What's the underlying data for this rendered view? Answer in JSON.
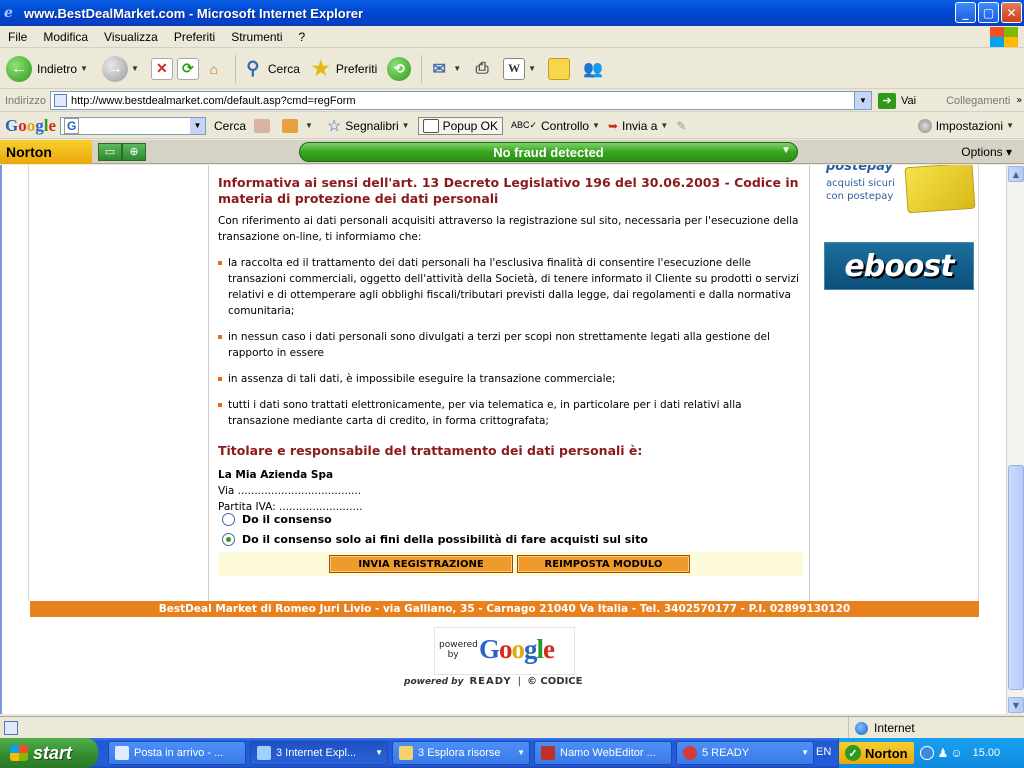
{
  "window": {
    "title": "www.BestDealMarket.com - Microsoft Internet Explorer",
    "controls": {
      "minimize": "_",
      "maximize": "▢",
      "close": "✕"
    }
  },
  "menu": [
    "File",
    "Modifica",
    "Visualizza",
    "Preferiti",
    "Strumenti",
    "?"
  ],
  "toolbar": {
    "back_label": "Indietro",
    "search_label": "Cerca",
    "favorites_label": "Preferiti"
  },
  "address": {
    "label": "Indirizzo",
    "url": "http://www.bestdealmarket.com/default.asp?cmd=regForm",
    "go_label": "Vai",
    "links_label": "Collegamenti"
  },
  "googlebar": {
    "logo": "Google",
    "search_value": "G",
    "search_label": "Cerca",
    "bookmarks_label": "Segnalibri",
    "popup_label": "Popup OK",
    "check_label": "Controllo",
    "send_label": "Invia a",
    "settings_label": "Impostazioni"
  },
  "norton": {
    "logo": "Norton",
    "status": "No fraud detected",
    "options_label": "Options"
  },
  "content": {
    "heading1": "Informativa ai sensi dell'art. 13 Decreto Legislativo 196 del 30.06.2003 - Codice in materia di protezione dei dati personali",
    "intro": "Con riferimento ai dati personali acquisiti attraverso la registrazione sul sito, necessaria per l'esecuzione della transazione on-line, ti informiamo che:",
    "bullets": [
      "la raccolta ed il trattamento dei dati personali ha l'esclusiva finalità di consentire l'esecuzione delle transazioni commerciali, oggetto dell'attività della Società, di tenere informato il Cliente su prodotti o servizi relativi e di ottemperare agli obblighi fiscali/tributari previsti dalla legge, dai regolamenti e dalla normativa comunitaria;",
      "in nessun caso i dati personali sono divulgati a terzi per scopi non strettamente legati alla gestione del rapporto in essere",
      "in assenza di tali dati, è impossibile eseguire la transazione commerciale;",
      "tutti i dati sono trattati elettronicamente, per via telematica e, in particolare per i dati relativi alla transazione mediante carta di credito, in forma crittografata;"
    ],
    "heading2": "Titolare e responsabile del trattamento dei dati personali è:",
    "company": "La Mia Azienda Spa",
    "street": "Via .....................................",
    "vat": "Partita IVA: ........................."
  },
  "form": {
    "radio1": "Do il consenso",
    "radio2": "Do il consenso solo ai fini della possibilità di fare acquisti sul sito",
    "submit_label": "INVIA REGISTRAZIONE",
    "reset_label": "REIMPOSTA MODULO"
  },
  "footer": {
    "text": "BestDeal Market di Romeo Juri Livio - via Galliano, 35 - Carnago 21040 Va Italia - Tel. 3402570177 - P.I. 02899130120",
    "powered_by_small": "powered\nby",
    "google_logo": "Google",
    "powered_by": "powered by",
    "ready": "READY",
    "codice": "© CODICE"
  },
  "ads": {
    "postepay_title": "postepay",
    "postepay_sub": "acquisti sicuri con postepay",
    "eboost": "eboost"
  },
  "statusbar": {
    "zone": "Internet"
  },
  "taskbar": {
    "start": "start",
    "tasks": [
      "Posta in arrivo - ...",
      "3 Internet Expl...",
      "3 Esplora risorse",
      "Namo WebEditor ...",
      "5 READY"
    ],
    "lang": "EN",
    "tray_norton": "Norton",
    "clock": "15.00"
  }
}
